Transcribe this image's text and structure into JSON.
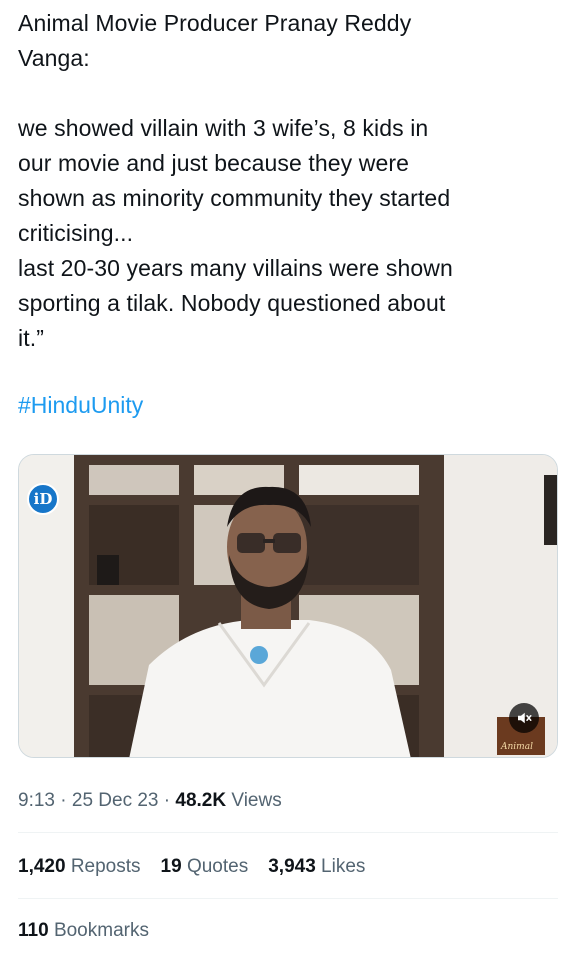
{
  "tweet": {
    "text": "Animal Movie Producer Pranay Reddy\nVanga:\n\nwe showed villain with 3 wife’s, 8 kids in\nour movie and just because they were\nshown as minority community they started\ncriticising...\nlast 20-30 years many villains were shown\nsporting a tilak. Nobody questioned about\nit.”",
    "hashtag": "#HinduUnity"
  },
  "media": {
    "type": "video",
    "channel_logo_text": "iD",
    "mute_icon": "speaker-muted-icon",
    "thumbnail_caption": "Animal"
  },
  "meta": {
    "time": "9:13",
    "separator": "·",
    "date": "25 Dec 23",
    "views_count": "48.2K",
    "views_label": "Views"
  },
  "stats": {
    "reposts_count": "1,420",
    "reposts_label": "Reposts",
    "quotes_count": "19",
    "quotes_label": "Quotes",
    "likes_count": "3,943",
    "likes_label": "Likes",
    "bookmarks_count": "110",
    "bookmarks_label": "Bookmarks"
  },
  "colors": {
    "text": "#0f1419",
    "secondary": "#536471",
    "link": "#1d9bf0",
    "divider": "#eff3f4"
  }
}
